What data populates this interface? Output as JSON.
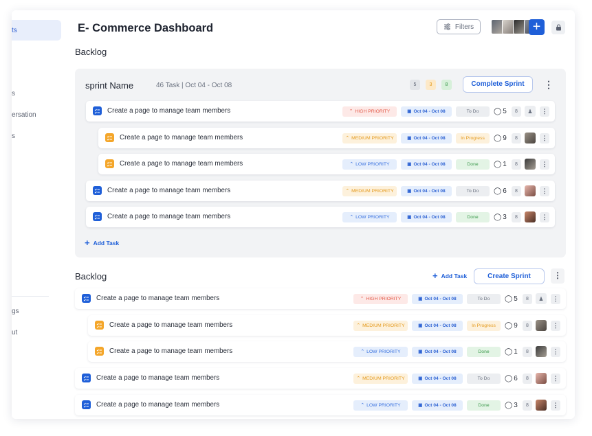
{
  "app": {
    "title": "E- Commerce Dashboard"
  },
  "sidebar": {
    "items": [
      {
        "label": "ts"
      },
      {
        "label": "s"
      },
      {
        "label": "ersation"
      },
      {
        "label": "s"
      },
      {
        "label": "gs"
      },
      {
        "label": "ut"
      }
    ]
  },
  "header": {
    "filters_label": "Filters"
  },
  "sections": {
    "backlog_top": "Backlog",
    "backlog_bottom": "Backlog"
  },
  "sprint": {
    "name": "sprint Name",
    "meta": "46 Task  |  Oct 04 - Oct 08",
    "counts": [
      "5",
      "3",
      "8"
    ],
    "complete_label": "Complete Sprint",
    "add_task_label": "Add Task"
  },
  "backlog": {
    "add_task_label": "Add Task",
    "create_sprint_label": "Create Sprint"
  },
  "priority_labels": {
    "high": "HIGH PRIORITY",
    "medium": "MEDIUM PRIORITY",
    "low": "LOW PRIORITY"
  },
  "status_labels": {
    "todo": "To Do",
    "progress": "In Progress",
    "done": "Done"
  },
  "tasks": [
    {
      "title": "Create a page to manage team members",
      "priority": "HIGH PRIORITY",
      "date": "Oct 04 - Oct 08",
      "status": "To Do",
      "comments": "5",
      "points": "8"
    },
    {
      "title": "Create a page to manage team members",
      "priority": "MEDIUM PRIORITY",
      "date": "Oct 04 - Oct 08",
      "status": "In Progress",
      "comments": "9",
      "points": "8"
    },
    {
      "title": "Create a page to manage team members",
      "priority": "LOW PRIORITY",
      "date": "Oct 04 - Oct 08",
      "status": "Done",
      "comments": "1",
      "points": "8"
    },
    {
      "title": "Create a page to manage team members",
      "priority": "MEDIUM PRIORITY",
      "date": "Oct 04 - Oct 08",
      "status": "To Do",
      "comments": "6",
      "points": "8"
    },
    {
      "title": "Create a page to manage team members",
      "priority": "LOW PRIORITY",
      "date": "Oct 04 - Oct 08",
      "status": "Done",
      "comments": "3",
      "points": "8"
    }
  ],
  "icons": {
    "filters": "sliders-icon",
    "add": "plus-icon",
    "lock": "lock-icon",
    "task": "checklist-icon",
    "comment": "comment-icon",
    "calendar": "calendar-icon",
    "more": "kebab-icon"
  },
  "colors": {
    "accent": "#1f5fd8",
    "high": "#e35a49",
    "medium": "#e49a1d",
    "low": "#3a72df",
    "done": "#3c9a4c"
  }
}
